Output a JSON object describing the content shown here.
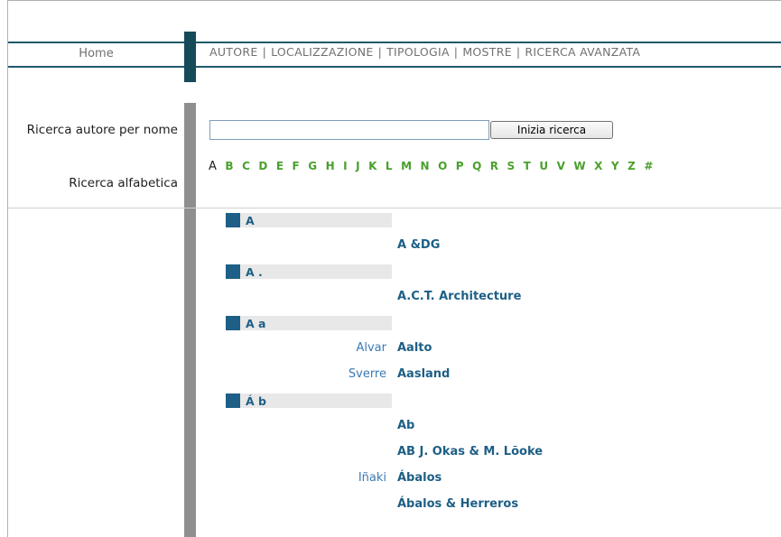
{
  "header": {
    "home_label": "Home",
    "nav": [
      {
        "label": "AUTORE"
      },
      {
        "label": "LOCALIZZAZIONE"
      },
      {
        "label": "TIPOLOGIA"
      },
      {
        "label": "MOSTRE"
      },
      {
        "label": "RICERCA AVANZATA"
      }
    ],
    "separator": "|"
  },
  "sidebar": {
    "search_by_name_label": "Ricerca autore per nome",
    "alpha_search_label": "Ricerca alfabetica"
  },
  "search": {
    "input_value": "",
    "button_label": "Inizia ricerca"
  },
  "alphabet": {
    "active": "A",
    "letters": [
      "A",
      "B",
      "C",
      "D",
      "E",
      "F",
      "G",
      "H",
      "I",
      "J",
      "K",
      "L",
      "M",
      "N",
      "O",
      "P",
      "Q",
      "R",
      "S",
      "T",
      "U",
      "V",
      "W",
      "X",
      "Y",
      "Z",
      "#"
    ]
  },
  "results": {
    "groups": [
      {
        "label": "A",
        "entries": [
          {
            "first": "",
            "last": "A &DG"
          }
        ]
      },
      {
        "label": "A .",
        "entries": [
          {
            "first": "",
            "last": "A.C.T. Architecture"
          }
        ]
      },
      {
        "label": "A a",
        "entries": [
          {
            "first": "Alvar",
            "last": "Aalto"
          },
          {
            "first": "Sverre",
            "last": "Aasland"
          }
        ]
      },
      {
        "label": "Á b",
        "entries": [
          {
            "first": "",
            "last": "Ab"
          },
          {
            "first": "",
            "last": "AB J. Okas & M. Lõoke"
          },
          {
            "first": "Iñaki",
            "last": "Ábalos"
          },
          {
            "first": "",
            "last": "Ábalos & Herreros"
          }
        ]
      }
    ]
  },
  "colors": {
    "nav_band": "#1f5b6b",
    "letter_link": "#4aa02c",
    "result_name": "#1d5f86",
    "first_name": "#3a7bb5"
  }
}
